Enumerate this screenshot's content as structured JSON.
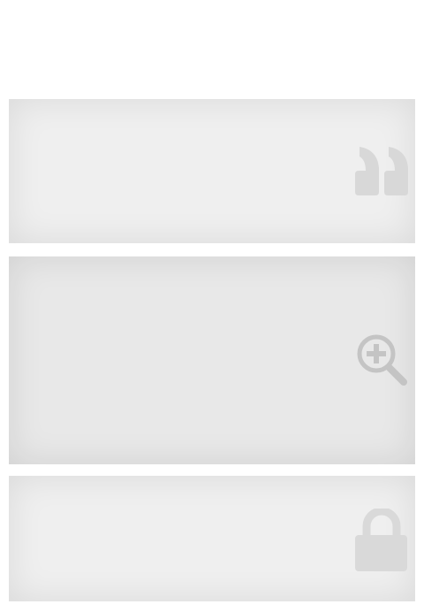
{
  "panels": [
    {
      "icon": "quote-icon",
      "background": "#efefef",
      "icon_color": "#d8d8d8"
    },
    {
      "icon": "zoom-in-icon",
      "background": "#e8e8e8",
      "icon_color": "#c4c4c4"
    },
    {
      "icon": "lock-icon",
      "background": "#efefef",
      "icon_color": "#d9d9d9"
    }
  ]
}
